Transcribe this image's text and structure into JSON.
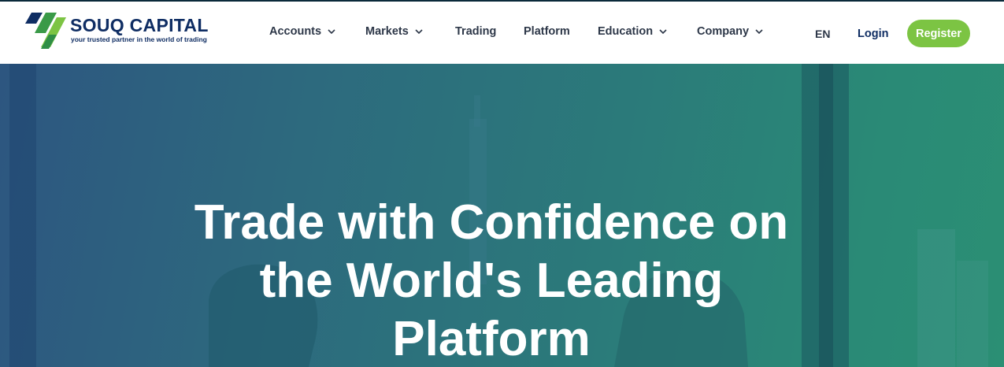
{
  "brand": {
    "name": "SOUQ CAPITAL",
    "tagline": "your trusted partner in the world of trading",
    "colors": {
      "navy": "#0f2d63",
      "green": "#7cc443",
      "teal": "#2b8f74"
    }
  },
  "nav": {
    "items": [
      {
        "label": "Accounts",
        "dropdown": true
      },
      {
        "label": "Markets",
        "dropdown": true
      },
      {
        "label": "Trading",
        "dropdown": false
      },
      {
        "label": "Platform",
        "dropdown": false
      },
      {
        "label": "Education",
        "dropdown": true
      },
      {
        "label": "Company",
        "dropdown": true
      }
    ]
  },
  "header_actions": {
    "language": "EN",
    "login_label": "Login",
    "register_label": "Register"
  },
  "hero": {
    "headline_lines": [
      "Trade with Confidence on",
      "the World's Leading",
      "Platform"
    ]
  }
}
